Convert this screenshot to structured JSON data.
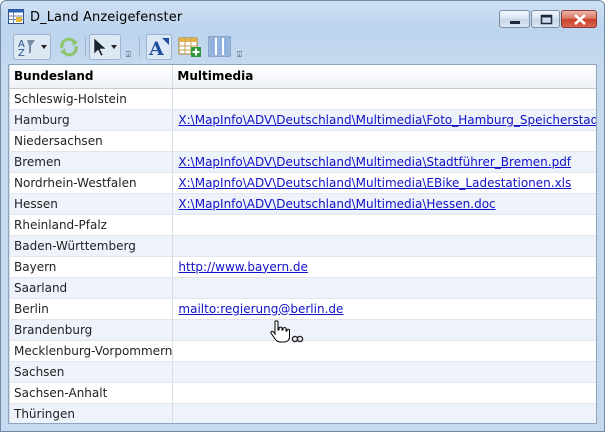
{
  "window": {
    "title": "D_Land Anzeigefenster",
    "icon": "table-window-icon"
  },
  "toolbar": {
    "buttons": [
      {
        "name": "sort-icon",
        "has_dropdown": true
      },
      {
        "name": "refresh-icon",
        "has_dropdown": false
      },
      {
        "name": "select-pointer-icon",
        "has_dropdown": true
      },
      {
        "name": "text-style-icon",
        "has_dropdown": false
      },
      {
        "name": "add-table-icon",
        "has_dropdown": false
      },
      {
        "name": "columns-icon",
        "has_dropdown": false
      }
    ],
    "overflow_glyph": "⍗"
  },
  "table": {
    "columns": [
      "Bundesland",
      "Multimedia"
    ],
    "rows": [
      {
        "bundesland": "Schleswig-Holstein",
        "multimedia": ""
      },
      {
        "bundesland": "Hamburg",
        "multimedia": "X:\\MapInfo\\ADV\\Deutschland\\Multimedia\\Foto_Hamburg_Speicherstadt.jpg"
      },
      {
        "bundesland": "Niedersachsen",
        "multimedia": ""
      },
      {
        "bundesland": "Bremen",
        "multimedia": "X:\\MapInfo\\ADV\\Deutschland\\Multimedia\\Stadtführer_Bremen.pdf"
      },
      {
        "bundesland": "Nordrhein-Westfalen",
        "multimedia": "X:\\MapInfo\\ADV\\Deutschland\\Multimedia\\EBike_Ladestationen.xls"
      },
      {
        "bundesland": "Hessen",
        "multimedia": "X:\\MapInfo\\ADV\\Deutschland\\Multimedia\\Hessen.doc"
      },
      {
        "bundesland": "Rheinland-Pfalz",
        "multimedia": ""
      },
      {
        "bundesland": "Baden-Württemberg",
        "multimedia": ""
      },
      {
        "bundesland": "Bayern",
        "multimedia": "http://www.bayern.de"
      },
      {
        "bundesland": "Saarland",
        "multimedia": ""
      },
      {
        "bundesland": "Berlin",
        "multimedia": "mailto:regierung@berlin.de"
      },
      {
        "bundesland": "Brandenburg",
        "multimedia": ""
      },
      {
        "bundesland": "Mecklenburg-Vorpommern",
        "multimedia": ""
      },
      {
        "bundesland": "Sachsen",
        "multimedia": ""
      },
      {
        "bundesland": "Sachsen-Anhalt",
        "multimedia": ""
      },
      {
        "bundesland": "Thüringen",
        "multimedia": ""
      }
    ]
  },
  "colors": {
    "link": "#1010c8",
    "row_alt": "#edf2fb",
    "frame": "#c5d9ef"
  },
  "cursor": "hand-link-cursor-icon"
}
